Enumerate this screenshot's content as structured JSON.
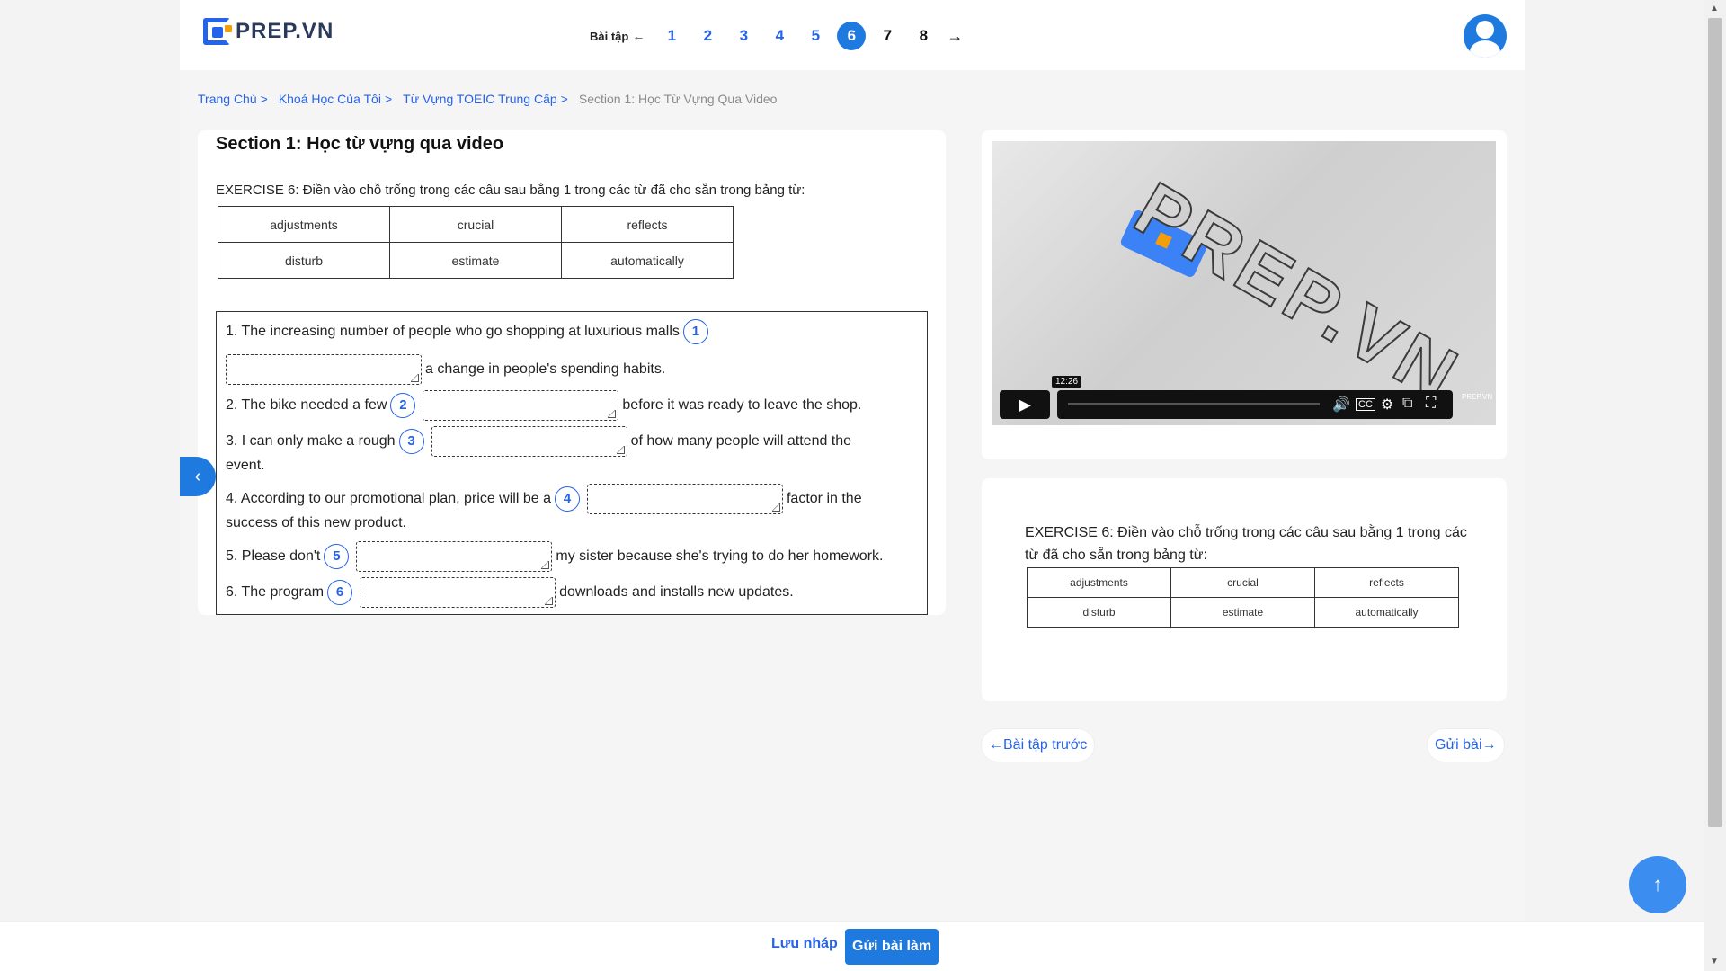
{
  "brand": {
    "name": "PREP.VN",
    "accent": "#1f7ae0"
  },
  "exercise_nav": {
    "label": "Bài tập",
    "back_arrow": "←",
    "numbers": [
      "1",
      "2",
      "3",
      "4",
      "5",
      "6",
      "7",
      "8"
    ],
    "active": "6",
    "next_arrow": "→"
  },
  "breadcrumb": {
    "items": [
      "Trang Chủ",
      "Khoá Học Của Tôi",
      "Từ Vựng TOEIC Trung Cấp"
    ],
    "separator": ">",
    "current": "Section 1: Học Từ Vựng Qua Video"
  },
  "section": {
    "title": "Section 1: Học từ vựng qua video",
    "exercise_title": "EXERCISE 6: Điền vào chỗ trống trong các câu sau bằng 1 trong các từ đã cho sẵn trong bảng từ:",
    "word_bank": [
      [
        "adjustments",
        "crucial",
        "reflects"
      ],
      [
        "disturb",
        "estimate",
        "automatically"
      ]
    ]
  },
  "questions": [
    {
      "n": "1",
      "before": "1. The increasing number of people who go shopping at luxurious malls",
      "after": "a change in people's spending habits."
    },
    {
      "n": "2",
      "before": "2. The bike needed a few",
      "after": "before it was ready to leave the shop."
    },
    {
      "n": "3",
      "before": "3. I can only make a rough",
      "after": "of how many people will attend the",
      "after2": "event."
    },
    {
      "n": "4",
      "before": "4. According to our promotional plan, price will be a",
      "after": "factor in the",
      "after2": "success of this new product."
    },
    {
      "n": "5",
      "before": "5. Please don't",
      "after": "my sister because she's trying to do her homework."
    },
    {
      "n": "6",
      "before": "6. The program",
      "after": "downloads and installs new updates."
    }
  ],
  "video": {
    "tooltip_time": "12:26",
    "watermark": "PREP.VN",
    "corner_logo": "PREP.VN"
  },
  "side_card": {
    "exercise_title": "EXERCISE 6: Điền vào chỗ trống trong các câu sau bằng 1 trong các từ đã cho sẵn trong bảng từ:",
    "word_bank": [
      [
        "adjustments",
        "crucial",
        "reflects"
      ],
      [
        "disturb",
        "estimate",
        "automatically"
      ]
    ]
  },
  "nav_buttons": {
    "prev": "←Bài tập trước",
    "submit": "Gửi bài→"
  },
  "bottom": {
    "save_draft": "Lưu nháp",
    "submit": "Gửi bài làm"
  },
  "icons": {
    "collapse": "chevron-left-icon",
    "scroll_top": "arrow-up-icon",
    "play": "play-icon",
    "avatar": "user-icon"
  }
}
